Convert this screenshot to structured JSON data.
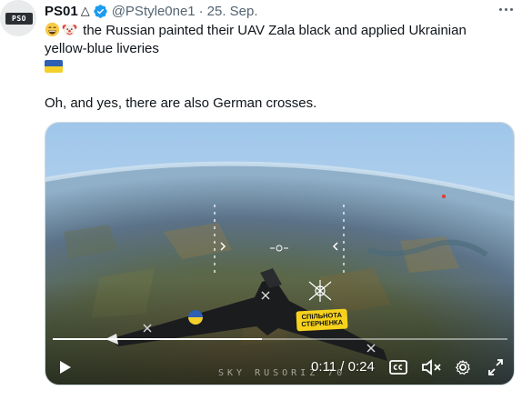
{
  "tweet": {
    "display_name": "PS01",
    "name_suffix": "△",
    "handle": "@PStyle0ne1",
    "separator": "·",
    "date": "25. Sep.",
    "text_line1": "the Russian painted their UAV Zala black and applied Ukrainian",
    "text_line2": "yellow-blue liveries",
    "text_line5": "Oh, and yes, there are also German crosses.",
    "avatar_text": "PSO"
  },
  "video": {
    "current_time": "0:11",
    "time_separator": " / ",
    "duration": "0:24",
    "progress": 0.46,
    "watermark": "SKY RUSORIZ 70",
    "overlay_line1": "СПІЛЬНОТА",
    "overlay_line2": "СТЕРНЕНКА"
  },
  "icons": {
    "verified": "verified-badge-icon",
    "more": "more-icon",
    "play": "play-icon",
    "captions": "captions-icon",
    "mute": "mute-icon",
    "settings": "settings-icon",
    "fullscreen": "fullscreen-icon"
  },
  "colors": {
    "verified_blue": "#1d9bf0",
    "flag_blue": "#2e5fb3",
    "flag_yellow": "#f4cf2a",
    "secondary_text": "#536471"
  }
}
